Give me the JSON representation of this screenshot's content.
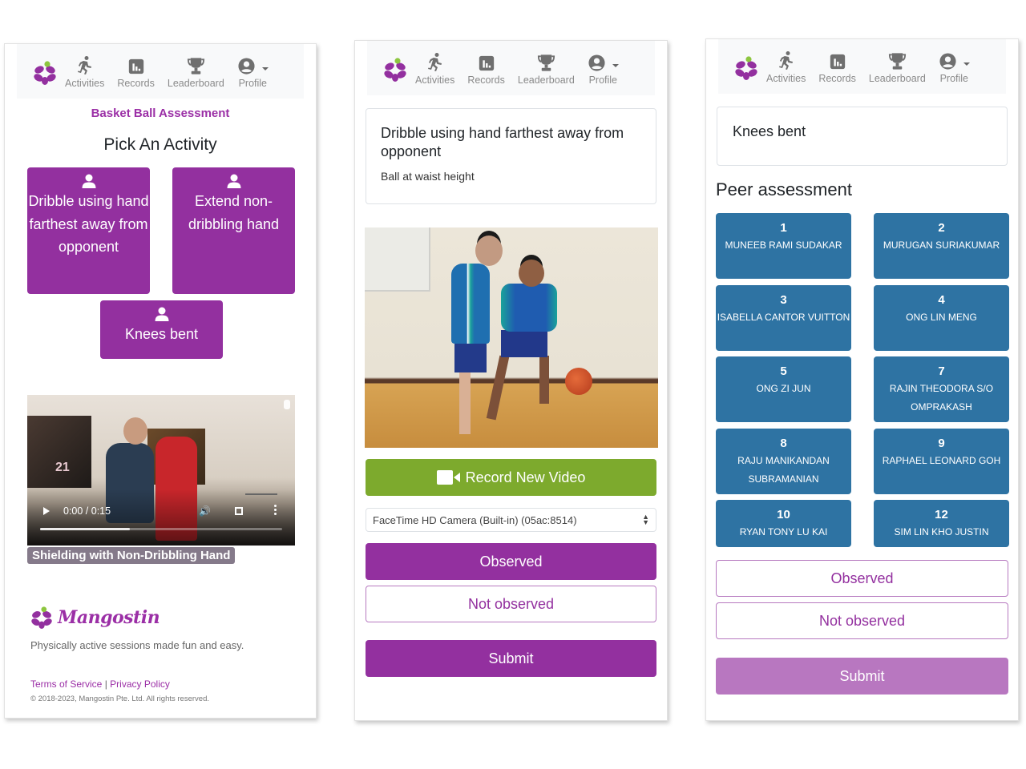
{
  "nav": {
    "items": [
      {
        "label": "Activities",
        "icon": "running-icon"
      },
      {
        "label": "Records",
        "icon": "bar-chart-icon"
      },
      {
        "label": "Leaderboard",
        "icon": "trophy-icon"
      },
      {
        "label": "Profile",
        "icon": "user-circle-icon"
      }
    ]
  },
  "colors": {
    "brand_purple": "#93309f",
    "brand_green": "#8dc63f",
    "record_green": "#7daa2d",
    "peer_blue": "#2e73a3",
    "submit_disabled": "#b877c0"
  },
  "screen1": {
    "assessment_title": "Basket Ball Assessment",
    "heading": "Pick An Activity",
    "activities": [
      {
        "label": "Dribble using hand farthest away from opponent"
      },
      {
        "label": "Extend non-dribbling hand"
      },
      {
        "label": "Knees bent"
      }
    ],
    "video": {
      "time": "0:00 / 0:15",
      "progress": 0.37,
      "caption": "Shielding with Non-Dribbling Hand"
    },
    "footer": {
      "brand": "Mangostin",
      "tagline": "Physically active sessions made fun and easy.",
      "terms": "Terms of Service",
      "separator": "|",
      "privacy": "Privacy Policy",
      "copyright": "© 2018-2023, Mangostin Pte. Ltd. All rights reserved."
    }
  },
  "screen2": {
    "card_title": "Dribble using hand farthest away from opponent",
    "card_subtitle": "Ball at waist height",
    "record_label": "Record New Video",
    "camera_selected": "FaceTime HD Camera (Built-in) (05ac:8514)",
    "observed_label": "Observed",
    "not_observed_label": "Not observed",
    "submit_label": "Submit"
  },
  "screen3": {
    "card_title": "Knees bent",
    "peer_title": "Peer assessment",
    "peers": [
      {
        "num": "1",
        "name": "MUNEEB RAMI SUDAKAR"
      },
      {
        "num": "2",
        "name": "MURUGAN SURIAKUMAR"
      },
      {
        "num": "3",
        "name": "ISABELLA CANTOR VUITTON"
      },
      {
        "num": "4",
        "name": "ONG LIN MENG"
      },
      {
        "num": "5",
        "name": "ONG ZI JUN"
      },
      {
        "num": "7",
        "name": "RAJIN THEODORA S/O OMPRAKASH"
      },
      {
        "num": "8",
        "name": "RAJU MANIKANDAN SUBRAMANIAN"
      },
      {
        "num": "9",
        "name": "RAPHAEL LEONARD GOH"
      },
      {
        "num": "10",
        "name": "RYAN TONY LU KAI"
      },
      {
        "num": "12",
        "name": "SIM LIN KHO JUSTIN"
      }
    ],
    "observed_label": "Observed",
    "not_observed_label": "Not observed",
    "submit_label": "Submit"
  }
}
